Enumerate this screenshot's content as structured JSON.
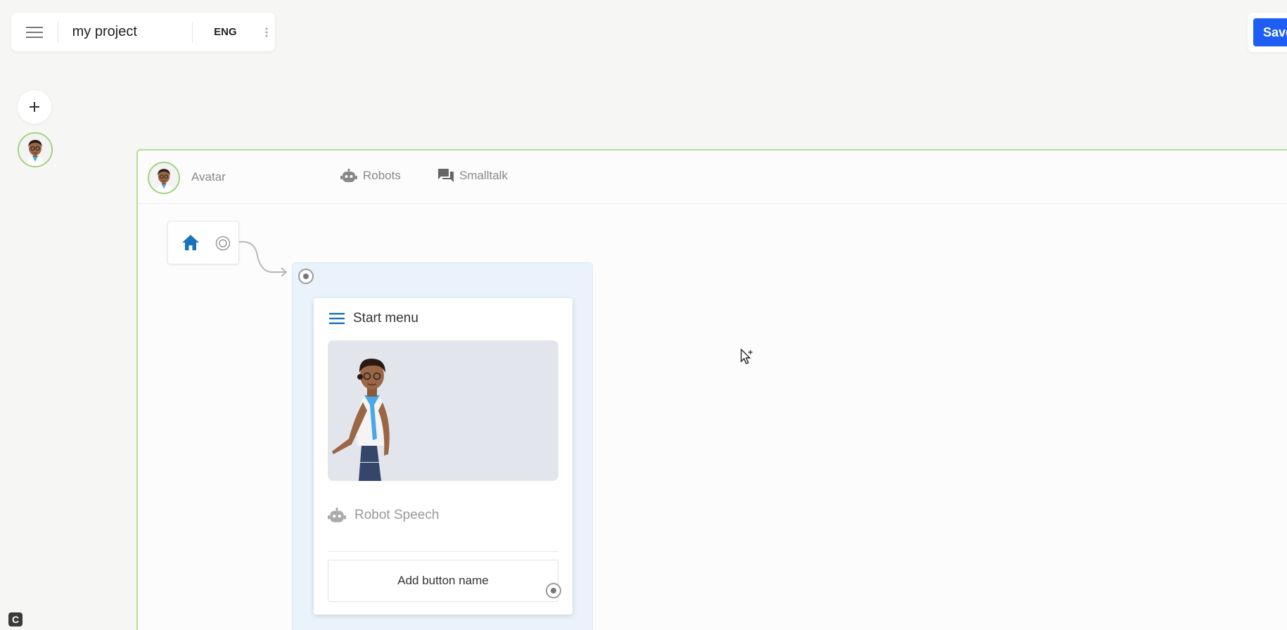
{
  "topbar": {
    "project_title": "my project",
    "language": "ENG",
    "menu_icon": "hamburger-menu-icon",
    "more_icon": "vertical-dots-icon"
  },
  "actions": {
    "save_label": "Save"
  },
  "sidebar": {
    "add_icon": "plus-icon",
    "avatar_icon": "avatar-thumbnail"
  },
  "canvas": {
    "header": {
      "avatar_label": "Avatar",
      "tabs": [
        {
          "label": "Robots",
          "icon": "robot-icon"
        },
        {
          "label": "Smalltalk",
          "icon": "chat-bubbles-icon"
        }
      ]
    },
    "home_node": {
      "icon": "home-icon",
      "output_icon": "target-port-icon"
    },
    "start_menu": {
      "title": "Start menu",
      "icon": "hamburger-menu-icon",
      "speech_label": "Robot Speech",
      "speech_icon": "robot-icon",
      "button_label": "Add button name"
    }
  },
  "colors": {
    "accent_blue": "#1e5ef5",
    "icon_blue": "#1a73b8",
    "panel_border_green": "#b5dc94",
    "group_bg": "#eaf3fb"
  }
}
